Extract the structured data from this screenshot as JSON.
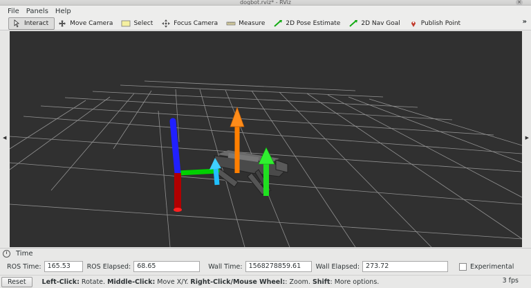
{
  "window": {
    "title": "dogbot.rviz* - RViz",
    "close_glyph": "×"
  },
  "menu": [
    "File",
    "Panels",
    "Help"
  ],
  "toolbar": {
    "tools": [
      {
        "label": "Interact",
        "icon": "interact-icon",
        "active": true
      },
      {
        "label": "Move Camera",
        "icon": "move-camera-icon",
        "active": false
      },
      {
        "label": "Select",
        "icon": "select-icon",
        "active": false
      },
      {
        "label": "Focus Camera",
        "icon": "focus-camera-icon",
        "active": false
      },
      {
        "label": "Measure",
        "icon": "measure-icon",
        "active": false
      },
      {
        "label": "2D Pose Estimate",
        "icon": "pose-estimate-arrow-icon",
        "active": false
      },
      {
        "label": "2D Nav Goal",
        "icon": "nav-goal-arrow-icon",
        "active": false
      },
      {
        "label": "Publish Point",
        "icon": "publish-point-pin-icon",
        "active": false
      }
    ],
    "more_glyph": "»"
  },
  "viewport": {
    "background": "#303030",
    "grid_color": "#a0a0a0",
    "axis_colors": {
      "x": "#00d000",
      "y": "#2020ff",
      "z": "#c00000"
    },
    "arrow_colors": {
      "orange": "#ff7f00",
      "green": "#20e020",
      "cyan": "#20c0ff"
    }
  },
  "time_panel": {
    "title": "Time",
    "ros_time_label": "ROS Time:",
    "ros_time": "165.53",
    "ros_elapsed_label": "ROS Elapsed:",
    "ros_elapsed": "68.65",
    "wall_time_label": "Wall Time:",
    "wall_time": "1568278859.61",
    "wall_elapsed_label": "Wall Elapsed:",
    "wall_elapsed": "273.72",
    "experimental_label": "Experimental"
  },
  "status": {
    "reset_label": "Reset",
    "help_parts": [
      {
        "text": "Left-Click:",
        "bold": true
      },
      {
        "text": " Rotate. ",
        "bold": false
      },
      {
        "text": "Middle-Click:",
        "bold": true
      },
      {
        "text": " Move X/Y. ",
        "bold": false
      },
      {
        "text": "Right-Click/Mouse Wheel:",
        "bold": true
      },
      {
        "text": ": Zoom. ",
        "bold": false
      },
      {
        "text": "Shift",
        "bold": true
      },
      {
        "text": ": More options.",
        "bold": false
      }
    ],
    "fps": "3 fps"
  }
}
